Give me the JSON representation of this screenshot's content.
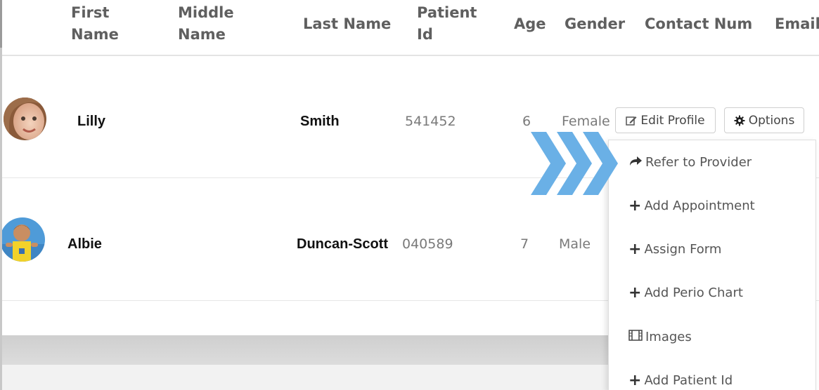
{
  "columns": {
    "first_name": [
      "First",
      "Name"
    ],
    "middle_name": [
      "Middle",
      "Name"
    ],
    "last_name": "Last Name",
    "patient_id": [
      "Patient",
      "Id"
    ],
    "age": "Age",
    "gender": "Gender",
    "contact": "Contact Num",
    "email": "Email"
  },
  "patients": [
    {
      "first": "Lilly",
      "middle": "",
      "last": "Smith",
      "id": "541452",
      "age": "6",
      "gender": "Female",
      "avatar": "girl-photo"
    },
    {
      "first": "Albie",
      "middle": "",
      "last": "Duncan-Scott",
      "id": "040589",
      "age": "7",
      "gender": "Male",
      "avatar": "boy-photo"
    }
  ],
  "actions": {
    "edit_profile": "Edit Profile",
    "options": "Options"
  },
  "options_menu": [
    {
      "label": "Refer to Provider",
      "icon": "share-arrow-icon"
    },
    {
      "label": "Add Appointment",
      "icon": "plus-icon"
    },
    {
      "label": "Assign Form",
      "icon": "plus-icon"
    },
    {
      "label": "Add Perio Chart",
      "icon": "plus-icon"
    },
    {
      "label": "Images",
      "icon": "film-icon"
    },
    {
      "label": "Add Patient Id",
      "icon": "plus-icon"
    }
  ],
  "colors": {
    "highlight_chevrons": "#6ab0e6",
    "header_text": "#5f5f5f"
  }
}
